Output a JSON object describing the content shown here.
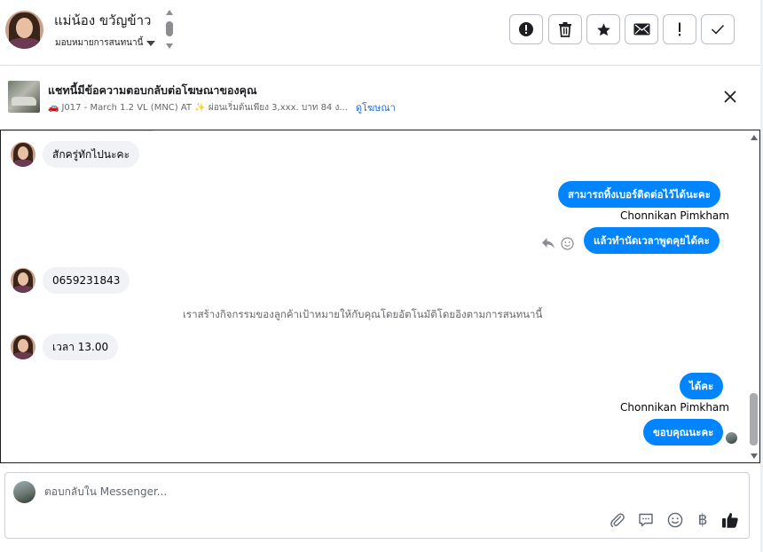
{
  "header": {
    "contact_name": "แม่น้อง ขวัญข้าว",
    "assign_label": "มอบหมายการสนทนานี้",
    "tools": {
      "flag_icon": "alert-circle-icon",
      "trash_icon": "trash-icon",
      "star_icon": "star-icon",
      "mail_icon": "envelope-icon",
      "important_icon": "exclamation-icon",
      "done_icon": "check-icon"
    }
  },
  "ad": {
    "title": "แชทนี้มีข้อความตอบกลับต่อโฆษณาของคุณ",
    "subtitle_emoji": "🚗",
    "subtitle": "J017 - March 1.2 VL (MNC) AT ✨ ผ่อนเริ่มต้นเพียง 3,xxx. บาท 84 ง...",
    "link": "ดูโฆษณา"
  },
  "messages": {
    "in_1": "สักครู่ทักไปนะคะ",
    "out_1": "สามารถทิ้งเบอร์ติดต่อไว้ได้นะคะ",
    "sender_1": "Chonnikan Pimkham",
    "out_2": "แล้วทำนัดเวลาพูดคุยได้คะ",
    "in_2": "0659231843",
    "system_1": "เราสร้างกิจกรรมของลูกค้าเป้าหมายให้กับคุณโดยอัตโนมัติโดยอิงตามการสนทนานี้",
    "in_3": "เวลา 13.00",
    "out_3": "ได้คะ",
    "sender_2": "Chonnikan Pimkham",
    "out_4": "ขอบคุณนะคะ"
  },
  "composer": {
    "placeholder": "ตอบกลับใน Messenger...",
    "currency_symbol": "฿"
  },
  "colors": {
    "outgoing_bubble": "#0084ff",
    "incoming_bubble": "#f0f2f5",
    "link": "#216fdb"
  }
}
